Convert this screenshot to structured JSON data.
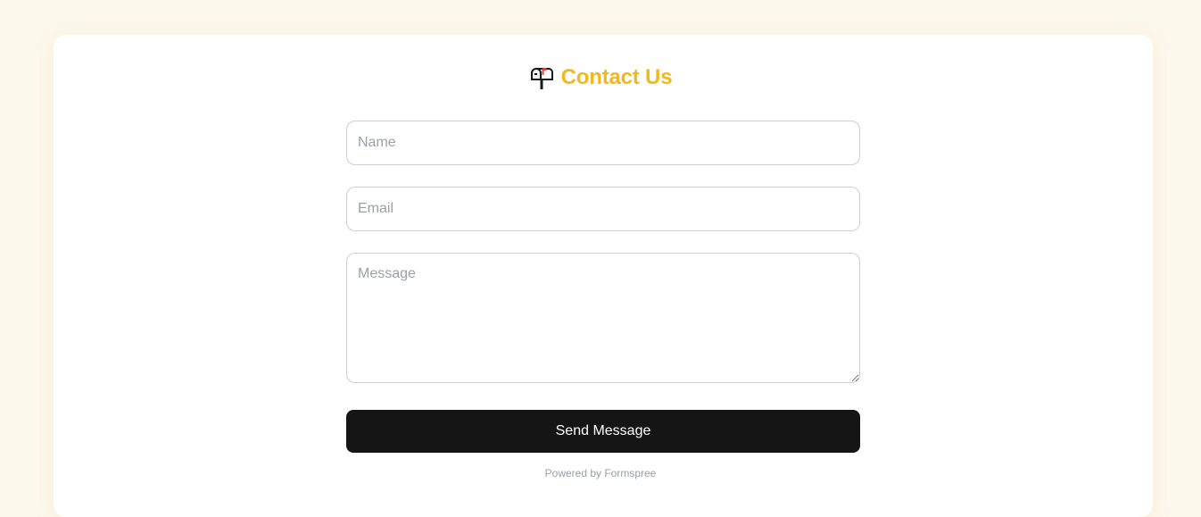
{
  "page": {
    "title_icon": "mailbox-icon",
    "title": "Contact Us"
  },
  "form": {
    "name_placeholder": "Name",
    "email_placeholder": "Email",
    "message_placeholder": "Message",
    "submit_label": "Send Message"
  },
  "footer": {
    "powered_by": "Powered by Formspree"
  },
  "colors": {
    "background": "#fdf8ec",
    "card": "#ffffff",
    "accent": "#f2b81e",
    "button": "#151515",
    "muted_text": "#9aa0a8"
  }
}
